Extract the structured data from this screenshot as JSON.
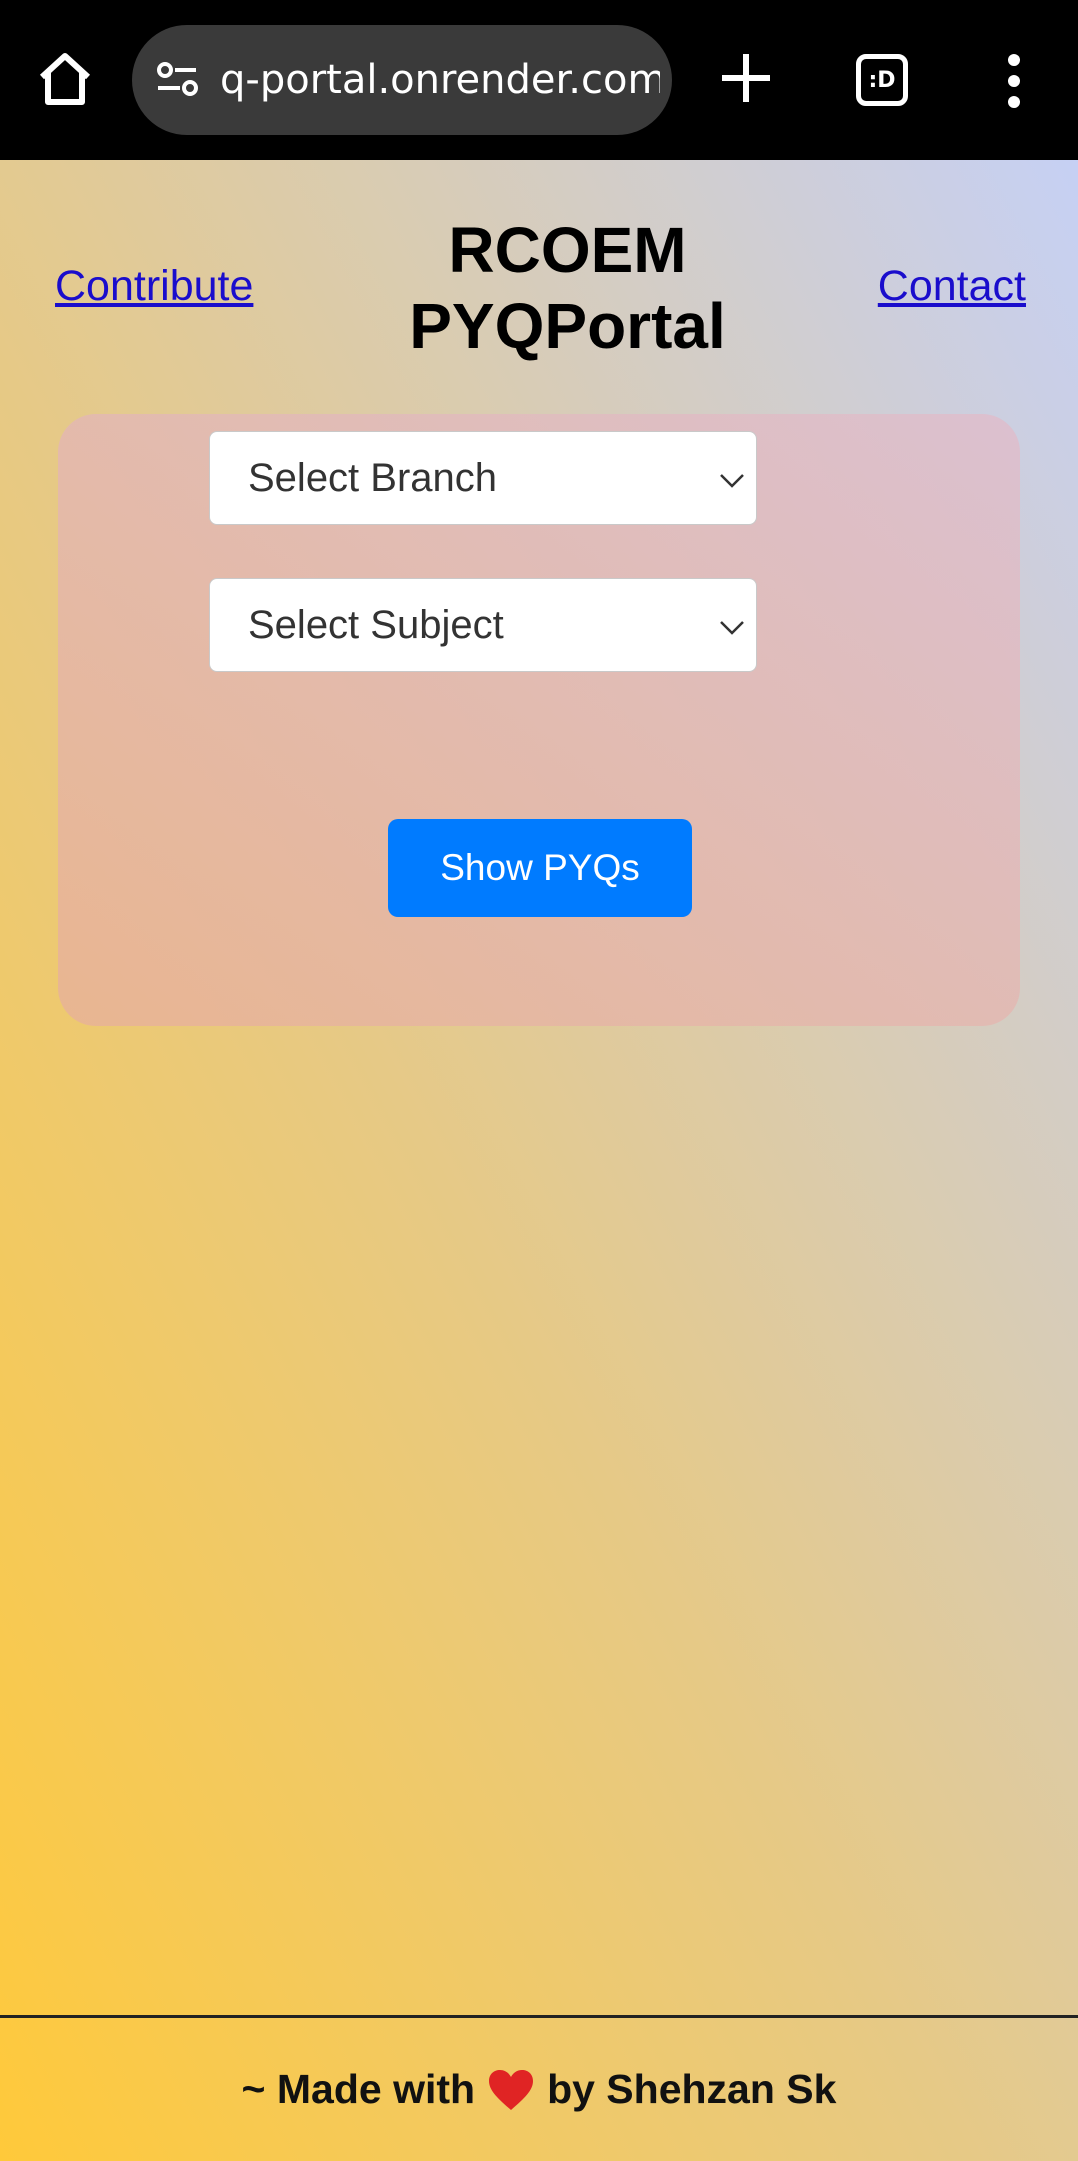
{
  "browser": {
    "url": "q-portal.onrender.com",
    "tab_count_label": ":D"
  },
  "nav": {
    "contribute_label": "Contribute",
    "contact_label": "Contact"
  },
  "header": {
    "title_line1": "RCOEM",
    "title_line2": "PYQPortal"
  },
  "form": {
    "branch_select": {
      "selected": "Select Branch"
    },
    "subject_select": {
      "selected": "Select Subject"
    },
    "submit_label": "Show PYQs"
  },
  "footer": {
    "prefix": "~ Made with",
    "suffix": "by Shehzan Sk",
    "heart_icon": "heart-icon"
  },
  "colors": {
    "link": "#1a0dcc",
    "button": "#007bff",
    "heart": "#e02424"
  }
}
